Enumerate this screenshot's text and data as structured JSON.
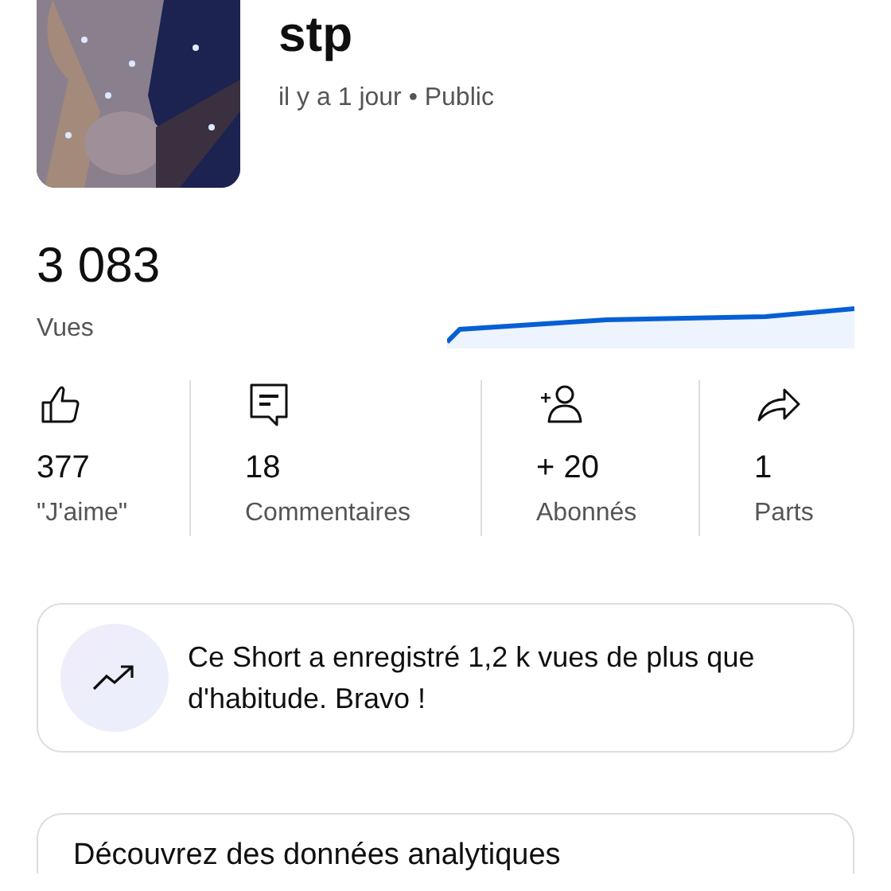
{
  "video": {
    "title": "stp",
    "meta": "il y a 1 jour • Public"
  },
  "views": {
    "count": "3 083",
    "label": "Vues"
  },
  "stats": [
    {
      "kind": "like",
      "value": "377",
      "label": "\"J'aime\""
    },
    {
      "kind": "comment",
      "value": "18",
      "label": "Commentaires"
    },
    {
      "kind": "subscriber",
      "value": "+ 20",
      "label": "Abonnés"
    },
    {
      "kind": "share",
      "value": "1",
      "label": "Parts"
    }
  ],
  "insight": {
    "text": "Ce Short a enregistré 1,2 k vues de plus que d'habitude. Bravo !"
  },
  "promo": {
    "title": "Découvrez des données analytiques"
  }
}
